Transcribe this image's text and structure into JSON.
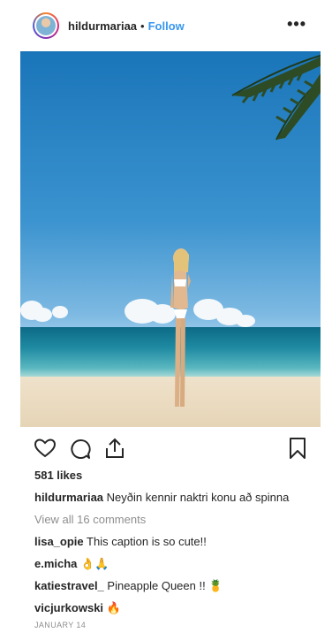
{
  "post": {
    "username": "hildurmariaa",
    "separator": "•",
    "follow_label": "Follow",
    "more_label": "•••",
    "likes": "581 likes",
    "caption": {
      "user": "hildurmariaa",
      "text": "Neyðin kennir naktri konu að spinna"
    },
    "view_all": "View all 16 comments",
    "comments": [
      {
        "user": "lisa_opie",
        "text": "This caption is so cute!!"
      },
      {
        "user": "e.micha",
        "text": "👌🙏"
      },
      {
        "user": "katiestravel_",
        "text": "Pineapple Queen !! 🍍"
      },
      {
        "user": "vicjurkowski",
        "text": "🔥"
      }
    ],
    "date": "JANUARY 14"
  },
  "icons": {
    "like": "heart-icon",
    "comment": "comment-icon",
    "share": "share-icon",
    "save": "bookmark-icon",
    "more": "more-icon"
  },
  "colors": {
    "link": "#3897f0",
    "text": "#262626",
    "muted": "#8e8e8e"
  }
}
